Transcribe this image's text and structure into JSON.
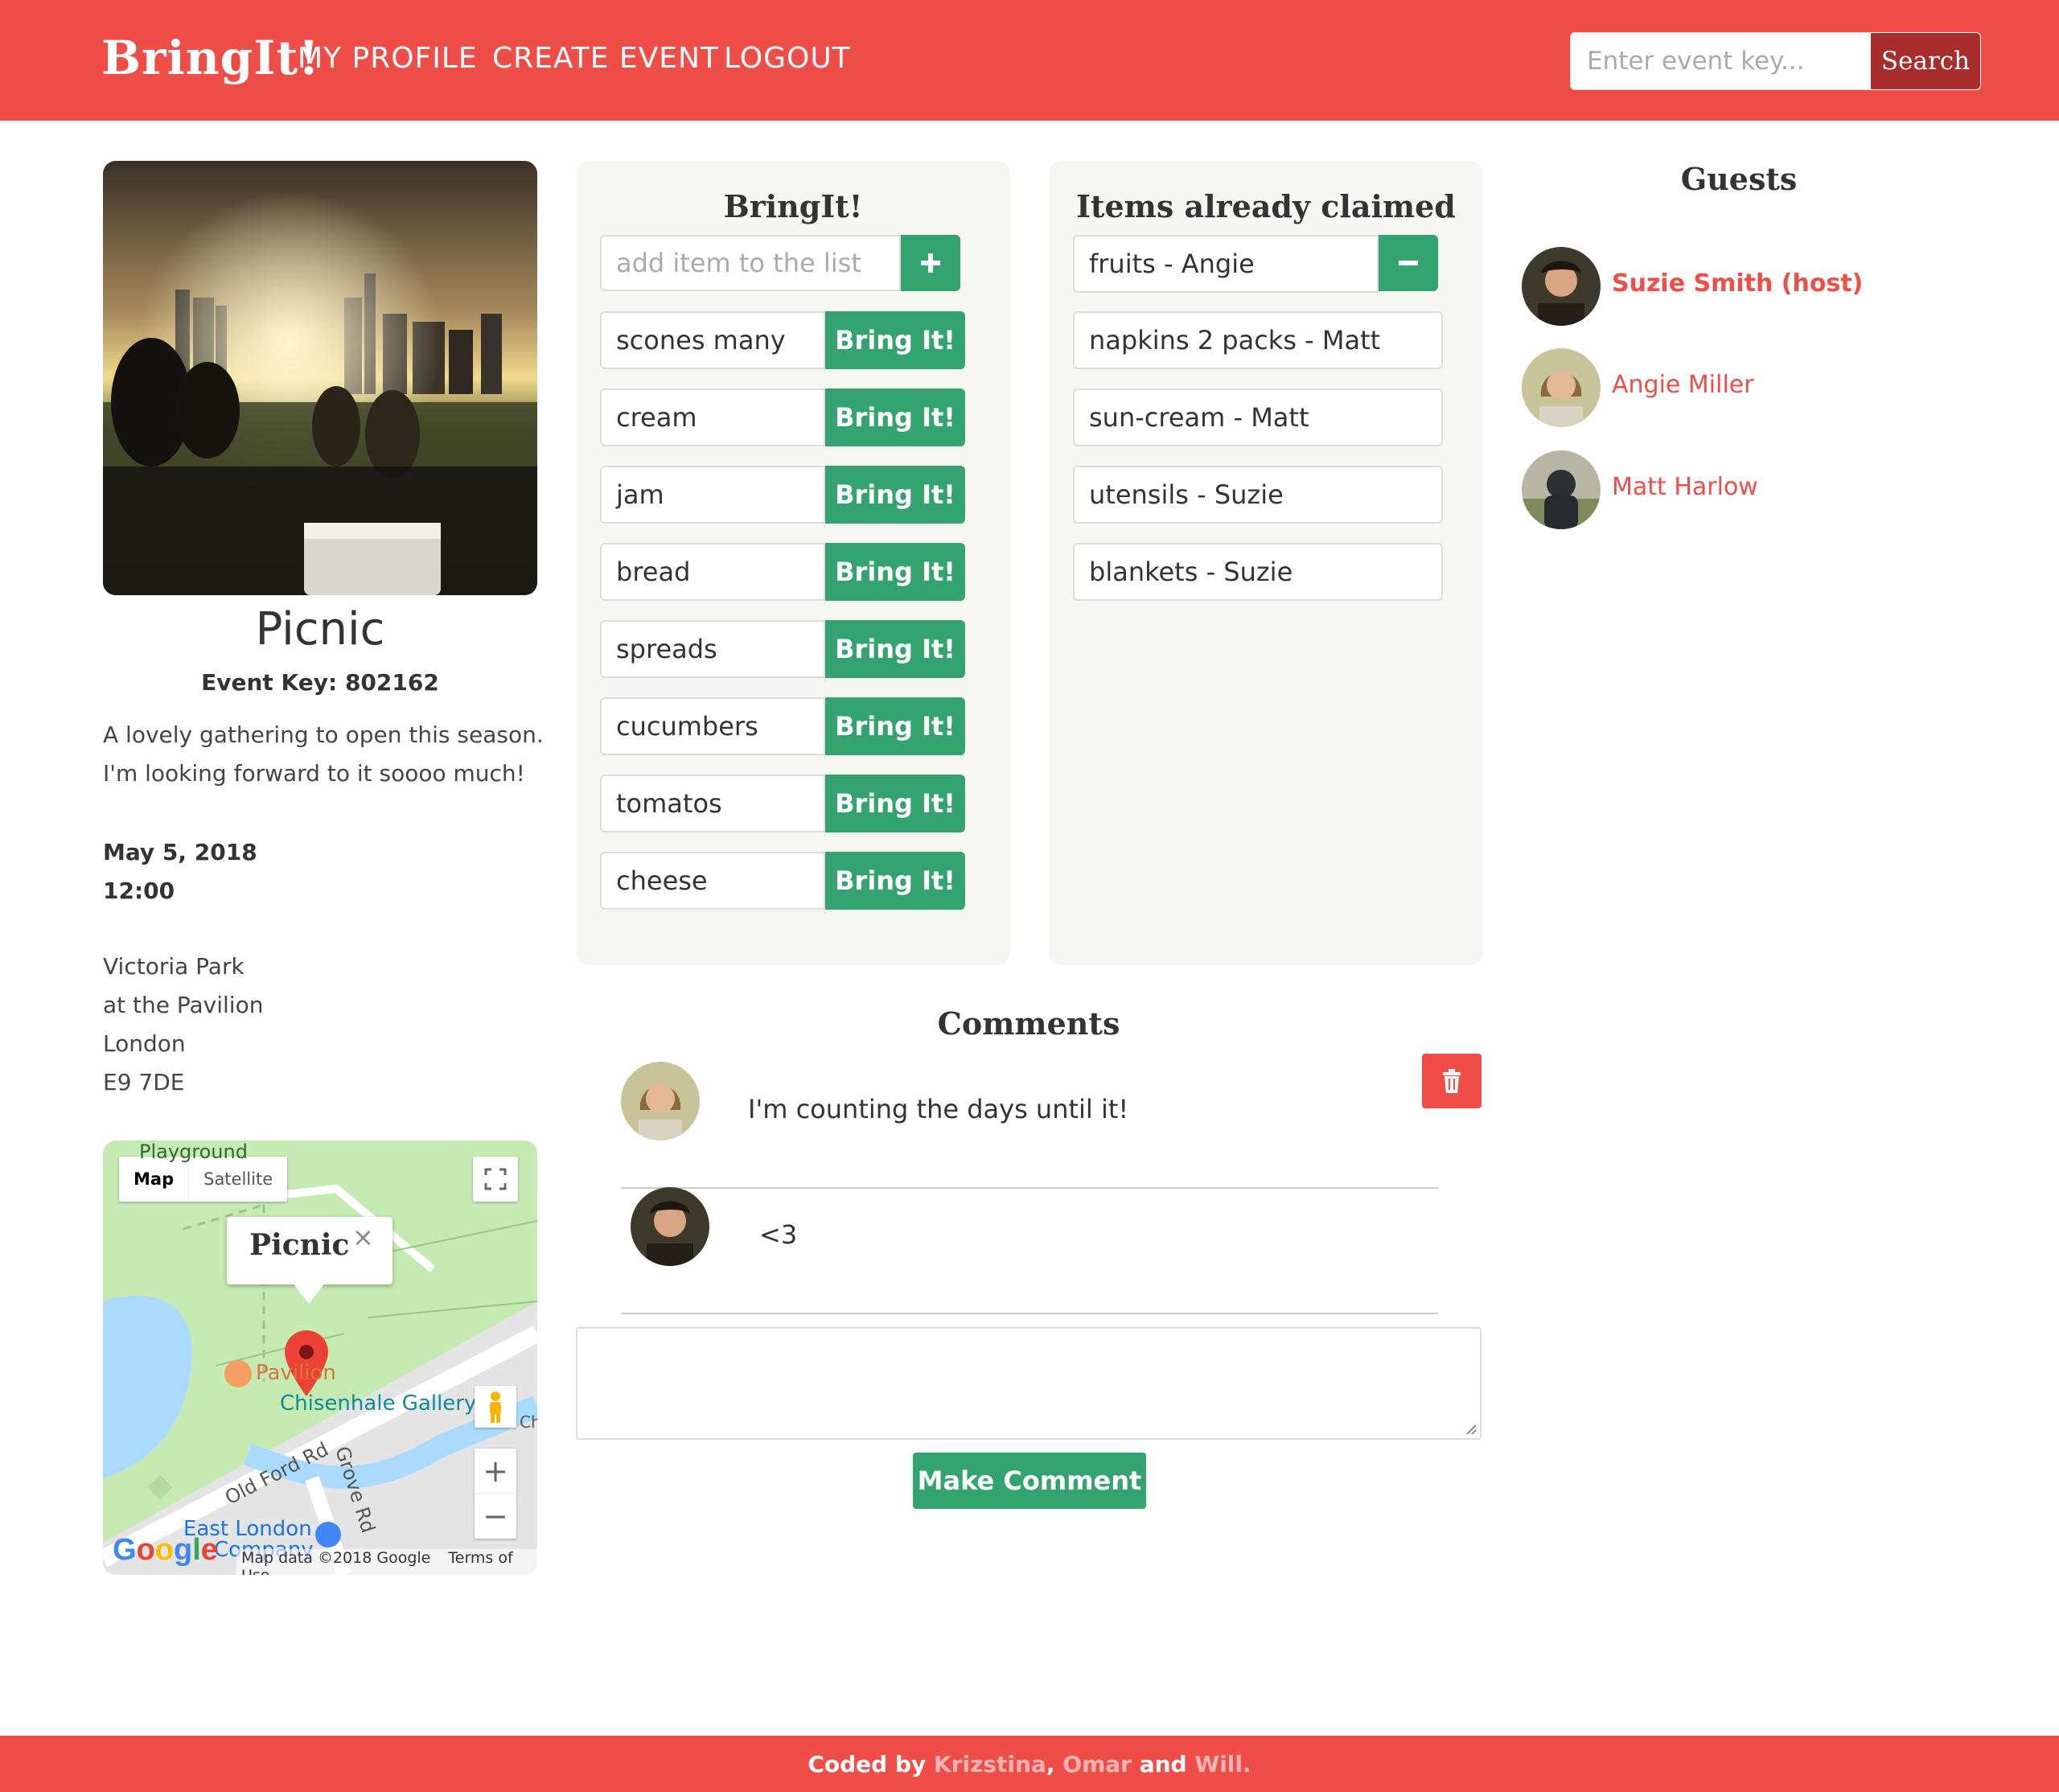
{
  "navbar": {
    "brand": "BringIt!",
    "links": [
      "MY PROFILE",
      "CREATE EVENT",
      "LOGOUT"
    ],
    "search_placeholder": "Enter event key...",
    "search_button": "Search"
  },
  "event": {
    "title": "Picnic",
    "key_label": "Event Key: 802162",
    "description_lines": [
      "A lovely gathering to open this season.",
      "I'm looking forward to it soooo much!"
    ],
    "date": "May 5, 2018",
    "time": "12:00",
    "address_lines": [
      "Victoria Park",
      "at the Pavilion",
      "London",
      "E9 7DE"
    ]
  },
  "map": {
    "type_map": "Map",
    "type_satellite": "Satellite",
    "infowindow_title": "Picnic",
    "close_glyph": "×",
    "label_playground": "Playground",
    "label_pavilion": "Pavilion",
    "label_gallery": "Chisenhale Gallery",
    "label_old_ford": "Old Ford Rd",
    "label_grove": "Grove Rd",
    "label_east_london": "East London",
    "label_company": "Company",
    "label_ch": "Ch",
    "zoom_in": "+",
    "zoom_out": "−",
    "google_logo": "Google",
    "map_data": "Map data ©2018 Google",
    "terms": "Terms of Use"
  },
  "bringit_panel": {
    "title": "BringIt!",
    "add_placeholder": "add item to the list",
    "add_icon": "plus-icon",
    "bring_label": "Bring It!",
    "items": [
      "scones many",
      "cream",
      "jam",
      "bread",
      "spreads",
      "cucumbers",
      "tomatos",
      "cheese"
    ]
  },
  "claimed_panel": {
    "title": "Items already claimed",
    "remove_icon": "minus-icon",
    "items": [
      "fruits - Angie",
      "napkins 2 packs - Matt",
      "sun-cream - Matt",
      "utensils - Suzie",
      "blankets - Suzie"
    ]
  },
  "guests": {
    "title": "Guests",
    "list": [
      "Suzie Smith (host)",
      "Angie Miller",
      "Matt Harlow"
    ]
  },
  "comments": {
    "title": "Comments",
    "list": [
      "I'm counting the days until it!",
      "<3"
    ],
    "delete_icon": "trash-icon",
    "textarea_placeholder": "",
    "submit_label": "Make Comment"
  },
  "footer": {
    "prefix": "Coded by",
    "names": [
      "Krizstina",
      "Omar",
      "Will."
    ],
    "sep1": ",",
    "sep2": "and"
  },
  "colors": {
    "brand_red": "#ef4d48",
    "accent_green": "#33a370",
    "dark_red": "#a92d2d",
    "panel_bg": "#f6f6f2"
  }
}
